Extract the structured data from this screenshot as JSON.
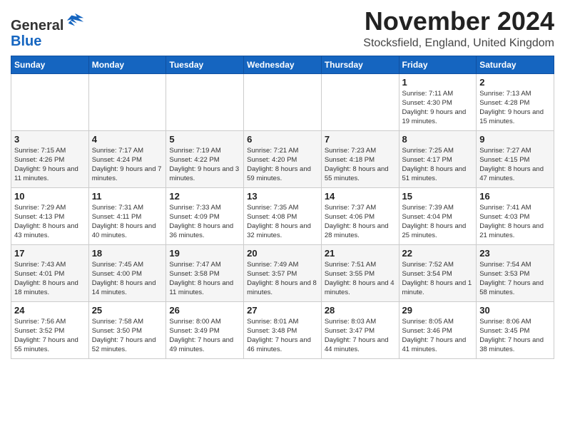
{
  "logo": {
    "general": "General",
    "blue": "Blue"
  },
  "title": "November 2024",
  "location": "Stocksfield, England, United Kingdom",
  "weekdays": [
    "Sunday",
    "Monday",
    "Tuesday",
    "Wednesday",
    "Thursday",
    "Friday",
    "Saturday"
  ],
  "weeks": [
    [
      {
        "day": "",
        "info": ""
      },
      {
        "day": "",
        "info": ""
      },
      {
        "day": "",
        "info": ""
      },
      {
        "day": "",
        "info": ""
      },
      {
        "day": "",
        "info": ""
      },
      {
        "day": "1",
        "info": "Sunrise: 7:11 AM\nSunset: 4:30 PM\nDaylight: 9 hours\nand 19 minutes."
      },
      {
        "day": "2",
        "info": "Sunrise: 7:13 AM\nSunset: 4:28 PM\nDaylight: 9 hours\nand 15 minutes."
      }
    ],
    [
      {
        "day": "3",
        "info": "Sunrise: 7:15 AM\nSunset: 4:26 PM\nDaylight: 9 hours\nand 11 minutes."
      },
      {
        "day": "4",
        "info": "Sunrise: 7:17 AM\nSunset: 4:24 PM\nDaylight: 9 hours\nand 7 minutes."
      },
      {
        "day": "5",
        "info": "Sunrise: 7:19 AM\nSunset: 4:22 PM\nDaylight: 9 hours\nand 3 minutes."
      },
      {
        "day": "6",
        "info": "Sunrise: 7:21 AM\nSunset: 4:20 PM\nDaylight: 8 hours\nand 59 minutes."
      },
      {
        "day": "7",
        "info": "Sunrise: 7:23 AM\nSunset: 4:18 PM\nDaylight: 8 hours\nand 55 minutes."
      },
      {
        "day": "8",
        "info": "Sunrise: 7:25 AM\nSunset: 4:17 PM\nDaylight: 8 hours\nand 51 minutes."
      },
      {
        "day": "9",
        "info": "Sunrise: 7:27 AM\nSunset: 4:15 PM\nDaylight: 8 hours\nand 47 minutes."
      }
    ],
    [
      {
        "day": "10",
        "info": "Sunrise: 7:29 AM\nSunset: 4:13 PM\nDaylight: 8 hours\nand 43 minutes."
      },
      {
        "day": "11",
        "info": "Sunrise: 7:31 AM\nSunset: 4:11 PM\nDaylight: 8 hours\nand 40 minutes."
      },
      {
        "day": "12",
        "info": "Sunrise: 7:33 AM\nSunset: 4:09 PM\nDaylight: 8 hours\nand 36 minutes."
      },
      {
        "day": "13",
        "info": "Sunrise: 7:35 AM\nSunset: 4:08 PM\nDaylight: 8 hours\nand 32 minutes."
      },
      {
        "day": "14",
        "info": "Sunrise: 7:37 AM\nSunset: 4:06 PM\nDaylight: 8 hours\nand 28 minutes."
      },
      {
        "day": "15",
        "info": "Sunrise: 7:39 AM\nSunset: 4:04 PM\nDaylight: 8 hours\nand 25 minutes."
      },
      {
        "day": "16",
        "info": "Sunrise: 7:41 AM\nSunset: 4:03 PM\nDaylight: 8 hours\nand 21 minutes."
      }
    ],
    [
      {
        "day": "17",
        "info": "Sunrise: 7:43 AM\nSunset: 4:01 PM\nDaylight: 8 hours\nand 18 minutes."
      },
      {
        "day": "18",
        "info": "Sunrise: 7:45 AM\nSunset: 4:00 PM\nDaylight: 8 hours\nand 14 minutes."
      },
      {
        "day": "19",
        "info": "Sunrise: 7:47 AM\nSunset: 3:58 PM\nDaylight: 8 hours\nand 11 minutes."
      },
      {
        "day": "20",
        "info": "Sunrise: 7:49 AM\nSunset: 3:57 PM\nDaylight: 8 hours\nand 8 minutes."
      },
      {
        "day": "21",
        "info": "Sunrise: 7:51 AM\nSunset: 3:55 PM\nDaylight: 8 hours\nand 4 minutes."
      },
      {
        "day": "22",
        "info": "Sunrise: 7:52 AM\nSunset: 3:54 PM\nDaylight: 8 hours\nand 1 minute."
      },
      {
        "day": "23",
        "info": "Sunrise: 7:54 AM\nSunset: 3:53 PM\nDaylight: 7 hours\nand 58 minutes."
      }
    ],
    [
      {
        "day": "24",
        "info": "Sunrise: 7:56 AM\nSunset: 3:52 PM\nDaylight: 7 hours\nand 55 minutes."
      },
      {
        "day": "25",
        "info": "Sunrise: 7:58 AM\nSunset: 3:50 PM\nDaylight: 7 hours\nand 52 minutes."
      },
      {
        "day": "26",
        "info": "Sunrise: 8:00 AM\nSunset: 3:49 PM\nDaylight: 7 hours\nand 49 minutes."
      },
      {
        "day": "27",
        "info": "Sunrise: 8:01 AM\nSunset: 3:48 PM\nDaylight: 7 hours\nand 46 minutes."
      },
      {
        "day": "28",
        "info": "Sunrise: 8:03 AM\nSunset: 3:47 PM\nDaylight: 7 hours\nand 44 minutes."
      },
      {
        "day": "29",
        "info": "Sunrise: 8:05 AM\nSunset: 3:46 PM\nDaylight: 7 hours\nand 41 minutes."
      },
      {
        "day": "30",
        "info": "Sunrise: 8:06 AM\nSunset: 3:45 PM\nDaylight: 7 hours\nand 38 minutes."
      }
    ]
  ]
}
